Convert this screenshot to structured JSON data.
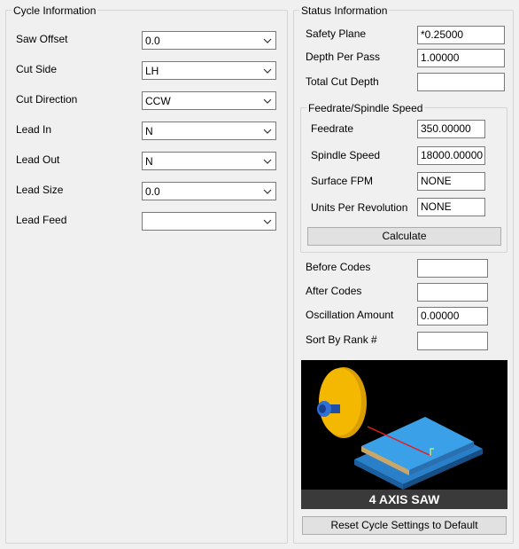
{
  "cycle_info": {
    "title": "Cycle Information",
    "fields": [
      {
        "label": "Saw Offset",
        "value": "0.0"
      },
      {
        "label": "Cut Side",
        "value": "LH"
      },
      {
        "label": "Cut Direction",
        "value": "CCW"
      },
      {
        "label": "Lead In",
        "value": "N"
      },
      {
        "label": "Lead Out",
        "value": "N"
      },
      {
        "label": "Lead Size",
        "value": "0.0"
      },
      {
        "label": "Lead Feed",
        "value": ""
      }
    ]
  },
  "status_info": {
    "title": "Status Information",
    "safety_plane": {
      "label": "Safety Plane",
      "value": "*0.25000"
    },
    "depth_per_pass": {
      "label": "Depth Per Pass",
      "value": "1.00000"
    },
    "total_cut_depth": {
      "label": "Total Cut Depth",
      "value": ""
    },
    "feedrate_group": {
      "title": "Feedrate/Spindle Speed",
      "feedrate": {
        "label": "Feedrate",
        "value": "350.00000"
      },
      "spindle_speed": {
        "label": "Spindle Speed",
        "value": "18000.00000"
      },
      "surface_fpm": {
        "label": "Surface FPM",
        "value": "NONE"
      },
      "units_per_rev": {
        "label": "Units Per Revolution",
        "value": "NONE"
      },
      "calculate_label": "Calculate"
    },
    "before_codes": {
      "label": "Before Codes",
      "value": ""
    },
    "after_codes": {
      "label": "After Codes",
      "value": ""
    },
    "oscillation_amount": {
      "label": "Oscillation Amount",
      "value": "0.00000"
    },
    "sort_by_rank": {
      "label": "Sort By Rank #",
      "value": ""
    },
    "preview_caption": "4 AXIS SAW",
    "reset_label": "Reset Cycle Settings to Default"
  },
  "colors": {
    "saw_blade": "#f5b800",
    "spindle": "#2f6fd8",
    "table": "#2a7fc9",
    "cut_line": "#e02020"
  }
}
